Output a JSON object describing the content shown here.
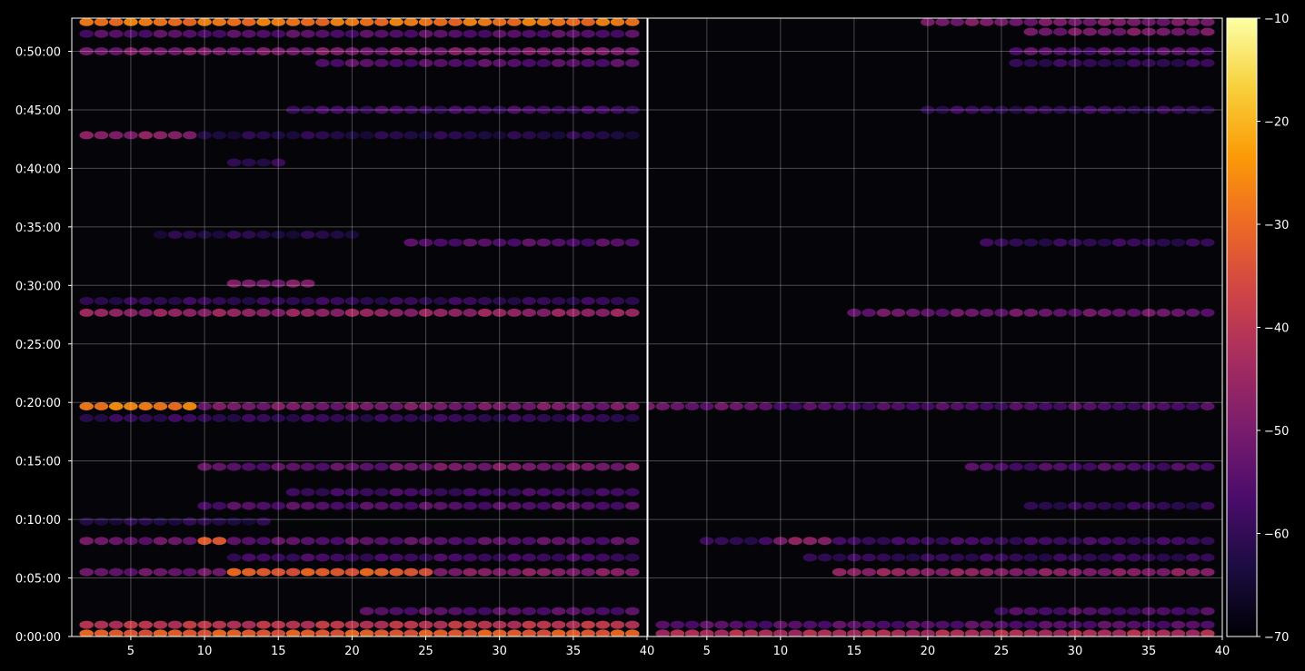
{
  "figure": {
    "background": "#000000",
    "foreground": "#ffffff"
  },
  "chart_data": [
    {
      "type": "heatmap",
      "panel": "left",
      "x_ticks": [
        "5",
        "10",
        "15",
        "20",
        "25",
        "30",
        "35",
        "40"
      ],
      "x_tick_values": [
        5,
        10,
        15,
        20,
        25,
        30,
        35,
        40
      ],
      "xlim": [
        1,
        40
      ],
      "y_ticks": [
        "0:00:00",
        "0:05:00",
        "0:10:00",
        "0:15:00",
        "0:20:00",
        "0:25:00",
        "0:30:00",
        "0:35:00",
        "0:40:00",
        "0:45:00",
        "0:50:00"
      ],
      "y_tick_values_s": [
        0,
        300,
        600,
        900,
        1200,
        1500,
        1800,
        2100,
        2400,
        2700,
        3000
      ],
      "ylim_s": [
        0,
        3170
      ],
      "grid": true,
      "bands": [
        {
          "t_s": 3150,
          "x": [
            2,
            39
          ],
          "db": -28
        },
        {
          "t_s": 3090,
          "x": [
            2,
            39
          ],
          "db": -55
        },
        {
          "t_s": 3000,
          "x": [
            2,
            39
          ],
          "db": -50
        },
        {
          "t_s": 2940,
          "x": [
            18,
            39
          ],
          "db": -55
        },
        {
          "t_s": 2700,
          "x": [
            16,
            39
          ],
          "db": -58
        },
        {
          "t_s": 2570,
          "x": [
            2,
            9
          ],
          "db": -48
        },
        {
          "t_s": 2570,
          "x": [
            10,
            39
          ],
          "db": -62
        },
        {
          "t_s": 2430,
          "x": [
            12,
            15
          ],
          "db": -60
        },
        {
          "t_s": 2060,
          "x": [
            7,
            20
          ],
          "db": -62
        },
        {
          "t_s": 2020,
          "x": [
            24,
            39
          ],
          "db": -55
        },
        {
          "t_s": 1810,
          "x": [
            12,
            17
          ],
          "db": -50
        },
        {
          "t_s": 1720,
          "x": [
            2,
            39
          ],
          "db": -60
        },
        {
          "t_s": 1660,
          "x": [
            2,
            39
          ],
          "db": -46
        },
        {
          "t_s": 1180,
          "x": [
            2,
            9
          ],
          "db": -27
        },
        {
          "t_s": 1180,
          "x": [
            10,
            39
          ],
          "db": -50
        },
        {
          "t_s": 1120,
          "x": [
            2,
            39
          ],
          "db": -60
        },
        {
          "t_s": 870,
          "x": [
            10,
            22
          ],
          "db": -54
        },
        {
          "t_s": 870,
          "x": [
            23,
            39
          ],
          "db": -50
        },
        {
          "t_s": 740,
          "x": [
            16,
            39
          ],
          "db": -58
        },
        {
          "t_s": 670,
          "x": [
            10,
            39
          ],
          "db": -55
        },
        {
          "t_s": 590,
          "x": [
            2,
            14
          ],
          "db": -62
        },
        {
          "t_s": 490,
          "x": [
            2,
            9
          ],
          "db": -52
        },
        {
          "t_s": 490,
          "x": [
            10,
            11
          ],
          "db": -32
        },
        {
          "t_s": 490,
          "x": [
            12,
            39
          ],
          "db": -54
        },
        {
          "t_s": 405,
          "x": [
            12,
            39
          ],
          "db": -58
        },
        {
          "t_s": 330,
          "x": [
            2,
            11
          ],
          "db": -52
        },
        {
          "t_s": 330,
          "x": [
            12,
            25
          ],
          "db": -32
        },
        {
          "t_s": 330,
          "x": [
            26,
            39
          ],
          "db": -48
        },
        {
          "t_s": 130,
          "x": [
            21,
            39
          ],
          "db": -55
        },
        {
          "t_s": 60,
          "x": [
            2,
            39
          ],
          "db": -40
        },
        {
          "t_s": 15,
          "x": [
            2,
            39
          ],
          "db": -32
        }
      ]
    },
    {
      "type": "heatmap",
      "panel": "right",
      "x_ticks": [
        "5",
        "10",
        "15",
        "20",
        "25",
        "30",
        "35",
        "40"
      ],
      "x_tick_values": [
        5,
        10,
        15,
        20,
        25,
        30,
        35,
        40
      ],
      "xlim": [
        1,
        40
      ],
      "y_ticks": [],
      "grid": true,
      "bands": [
        {
          "t_s": 3150,
          "x": [
            20,
            39
          ],
          "db": -50
        },
        {
          "t_s": 3100,
          "x": [
            27,
            39
          ],
          "db": -50
        },
        {
          "t_s": 3000,
          "x": [
            26,
            39
          ],
          "db": -55
        },
        {
          "t_s": 2940,
          "x": [
            26,
            39
          ],
          "db": -60
        },
        {
          "t_s": 2700,
          "x": [
            20,
            39
          ],
          "db": -60
        },
        {
          "t_s": 2020,
          "x": [
            24,
            39
          ],
          "db": -60
        },
        {
          "t_s": 1660,
          "x": [
            15,
            39
          ],
          "db": -52
        },
        {
          "t_s": 1180,
          "x": [
            1,
            9
          ],
          "db": -52
        },
        {
          "t_s": 1180,
          "x": [
            10,
            39
          ],
          "db": -56
        },
        {
          "t_s": 870,
          "x": [
            23,
            39
          ],
          "db": -56
        },
        {
          "t_s": 670,
          "x": [
            27,
            39
          ],
          "db": -60
        },
        {
          "t_s": 490,
          "x": [
            5,
            9
          ],
          "db": -60
        },
        {
          "t_s": 490,
          "x": [
            10,
            13
          ],
          "db": -48
        },
        {
          "t_s": 490,
          "x": [
            14,
            39
          ],
          "db": -58
        },
        {
          "t_s": 405,
          "x": [
            12,
            39
          ],
          "db": -60
        },
        {
          "t_s": 330,
          "x": [
            14,
            25
          ],
          "db": -46
        },
        {
          "t_s": 330,
          "x": [
            26,
            39
          ],
          "db": -48
        },
        {
          "t_s": 130,
          "x": [
            25,
            39
          ],
          "db": -56
        },
        {
          "t_s": 60,
          "x": [
            2,
            39
          ],
          "db": -55
        },
        {
          "t_s": 15,
          "x": [
            2,
            39
          ],
          "db": -42
        }
      ]
    }
  ],
  "colorbar": {
    "ticks": [
      "−10",
      "−20",
      "−30",
      "−40",
      "−50",
      "−60",
      "−70"
    ],
    "tick_values": [
      -10,
      -20,
      -30,
      -40,
      -50,
      -60,
      -70
    ],
    "range": [
      -70,
      -10
    ],
    "colormap": [
      "#000004",
      "#1b0c41",
      "#4a0c6b",
      "#781c6d",
      "#a52c60",
      "#cf4446",
      "#ed6925",
      "#fb9b06",
      "#f7d13d",
      "#fcffa4"
    ]
  }
}
